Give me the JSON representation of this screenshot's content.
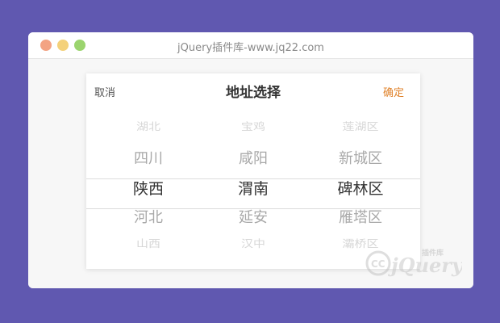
{
  "window": {
    "title": "jQuery插件库-www.jq22.com"
  },
  "picker": {
    "cancel_label": "取消",
    "title": "地址选择",
    "confirm_label": "确定"
  },
  "columns": {
    "province": [
      "湖北",
      "四川",
      "陕西",
      "河北",
      "山西"
    ],
    "city": [
      "宝鸡",
      "咸阳",
      "渭南",
      "延安",
      "汉中"
    ],
    "district": [
      "莲湖区",
      "新城区",
      "碑林区",
      "雁塔区",
      "灞桥区"
    ]
  },
  "selected": {
    "province": "陕西",
    "city": "渭南",
    "district": "碑林区"
  },
  "watermark": {
    "brand": "jQuery",
    "cn_label": "插件库"
  },
  "colors": {
    "page_background": "#6058b0",
    "confirm": "#e0822a",
    "traffic_red": "#f3a383",
    "traffic_yellow": "#f4d17a",
    "traffic_green": "#9bd46e"
  }
}
